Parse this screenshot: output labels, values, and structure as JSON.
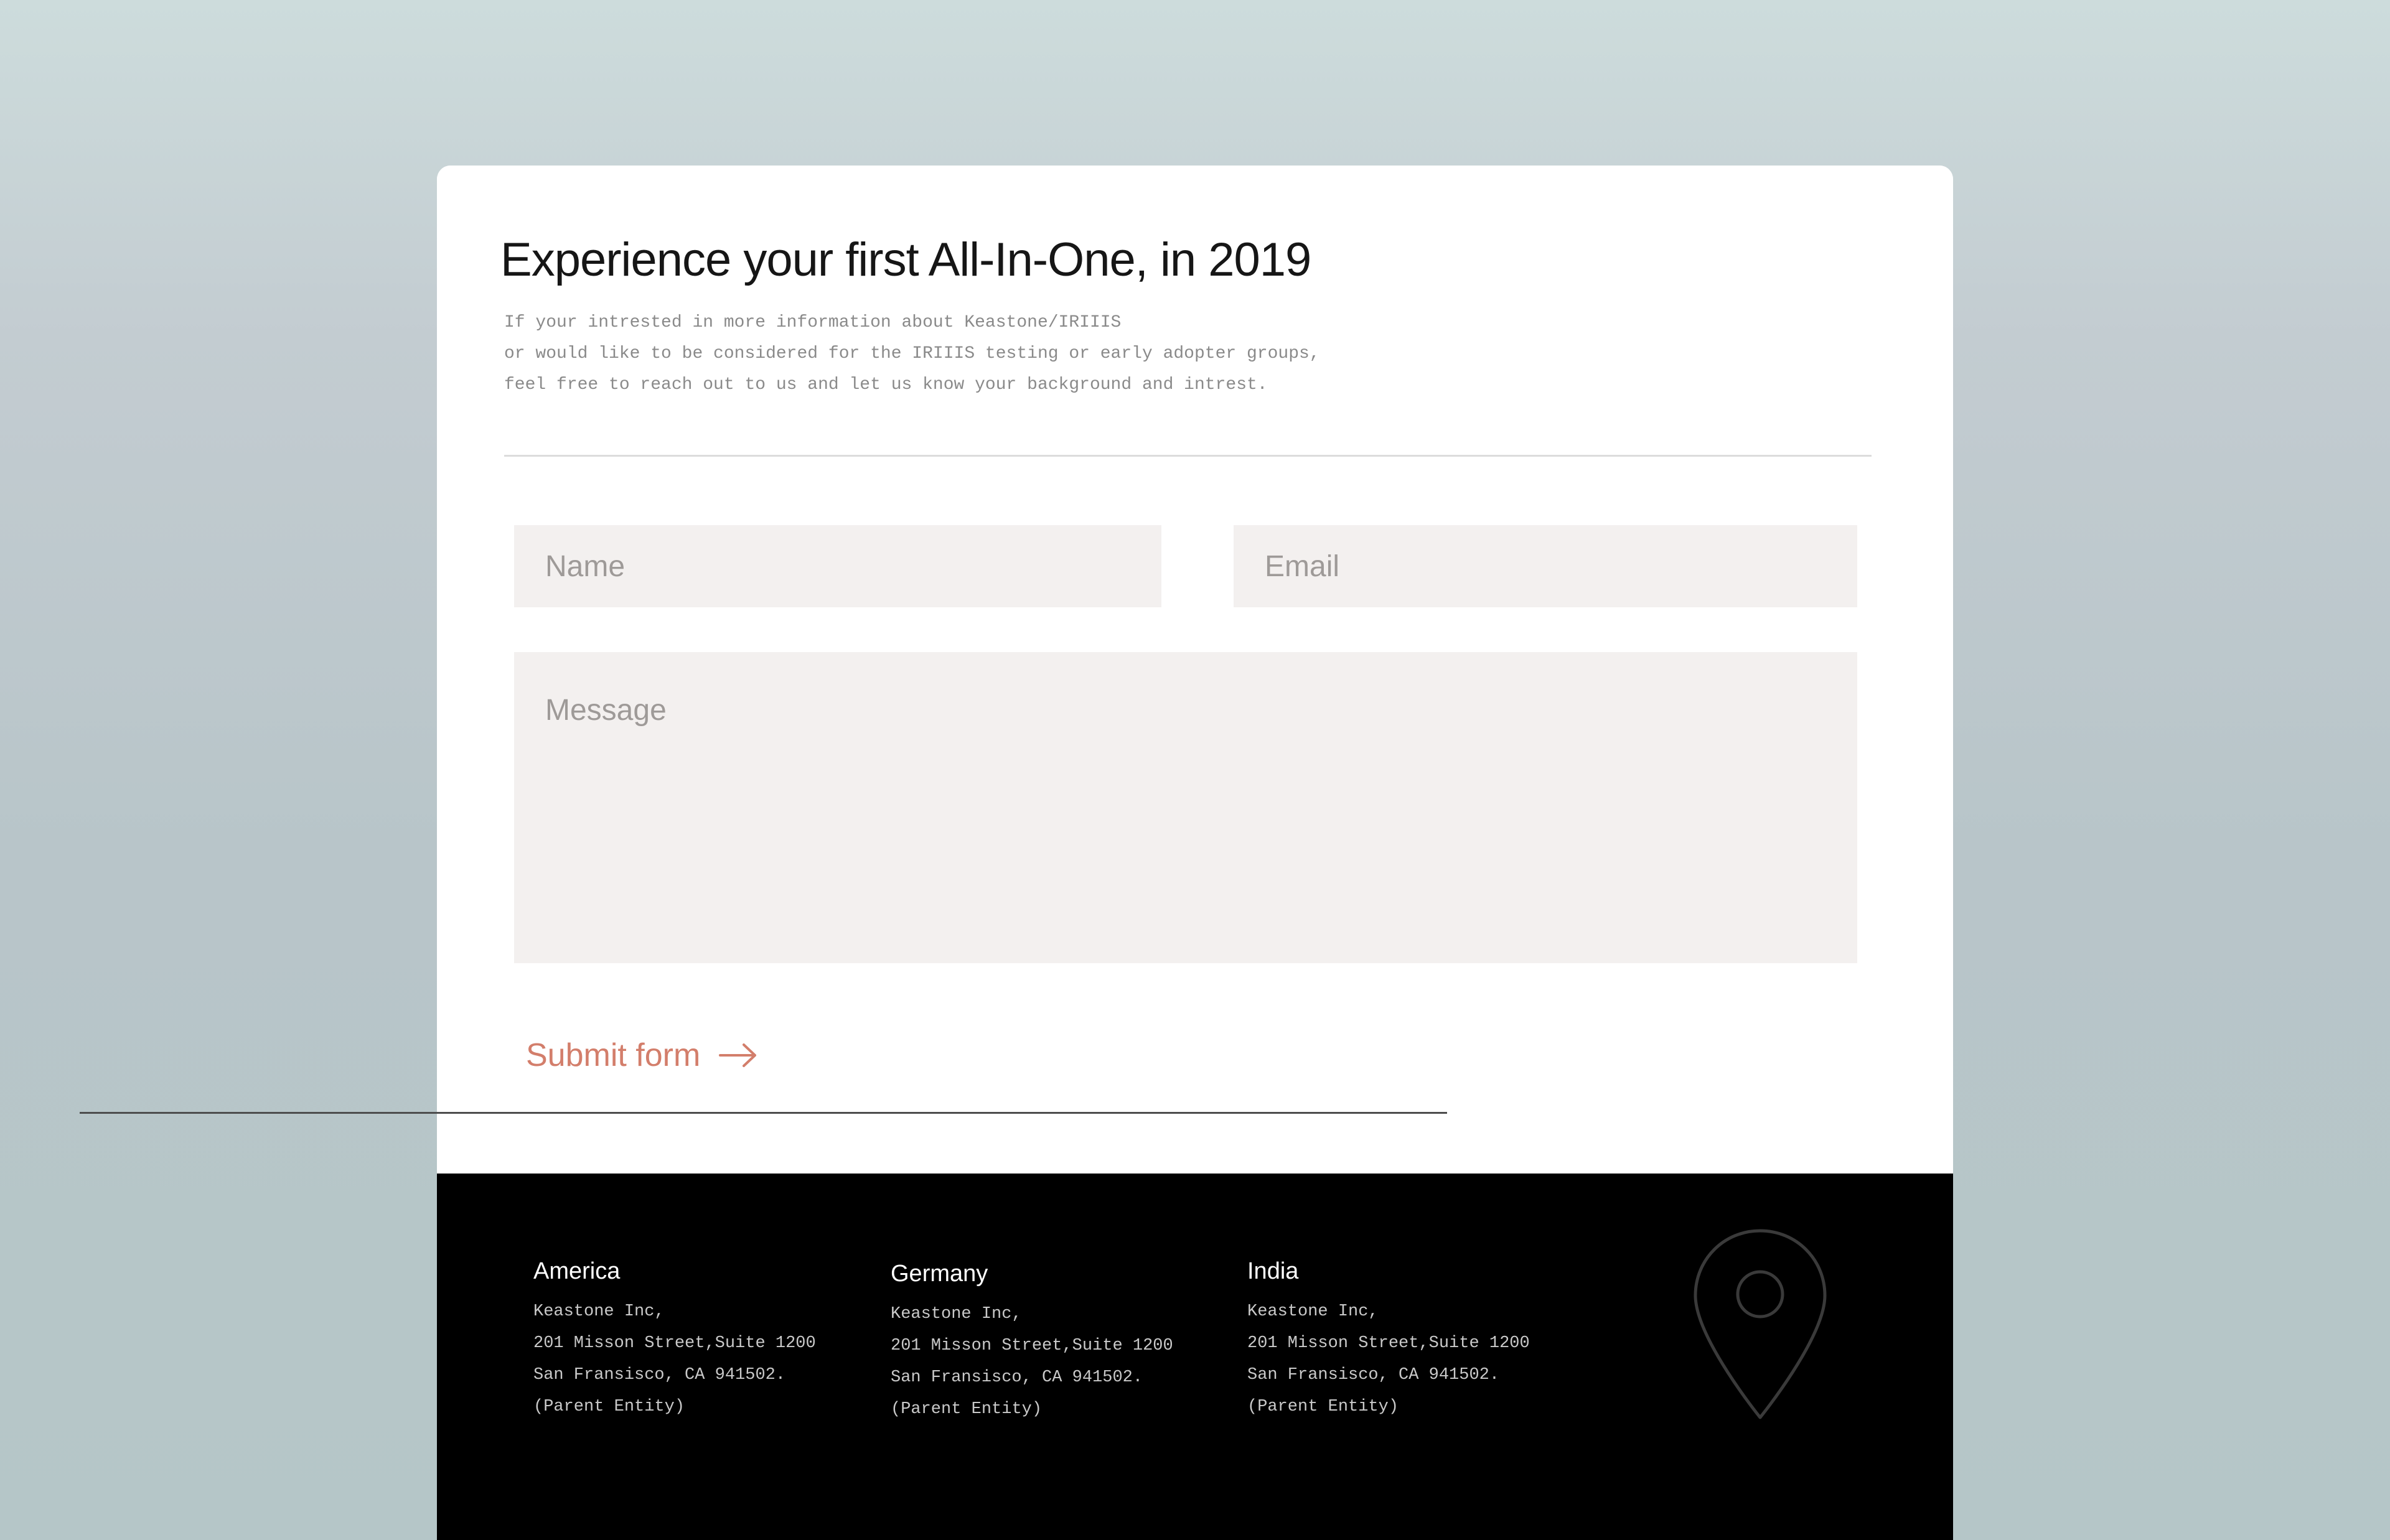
{
  "form": {
    "title": "Experience your first All-In-One, in 2019",
    "intro_lines": [
      "If your intrested in more information about Keastone/IRIIIS",
      "or would like to be considered for the IRIIIS testing or early adopter groups,",
      "feel free to reach out to us and let us know your background and intrest."
    ],
    "name_placeholder": "Name",
    "email_placeholder": "Email",
    "message_placeholder": "Message",
    "submit_label": "Submit form"
  },
  "icons": {
    "submit": "arrow-right-icon",
    "footer": "map-pin-icon"
  },
  "colors": {
    "accent": "#d37e6b",
    "field_bg": "#f3f0ef",
    "footer_bg": "#000000"
  },
  "footer": {
    "offices": [
      {
        "name": "America",
        "lines": [
          "Keastone Inc,",
          "201 Misson Street,Suite 1200",
          "San Fransisco, CA 941502.",
          "(Parent Entity)"
        ]
      },
      {
        "name": "Germany",
        "lines": [
          "Keastone Inc,",
          "201 Misson Street,Suite 1200",
          "San Fransisco, CA 941502.",
          "(Parent Entity)"
        ]
      },
      {
        "name": "India",
        "lines": [
          "Keastone Inc,",
          "201 Misson Street,Suite 1200",
          "San Fransisco, CA 941502.",
          "(Parent Entity)"
        ]
      }
    ]
  }
}
